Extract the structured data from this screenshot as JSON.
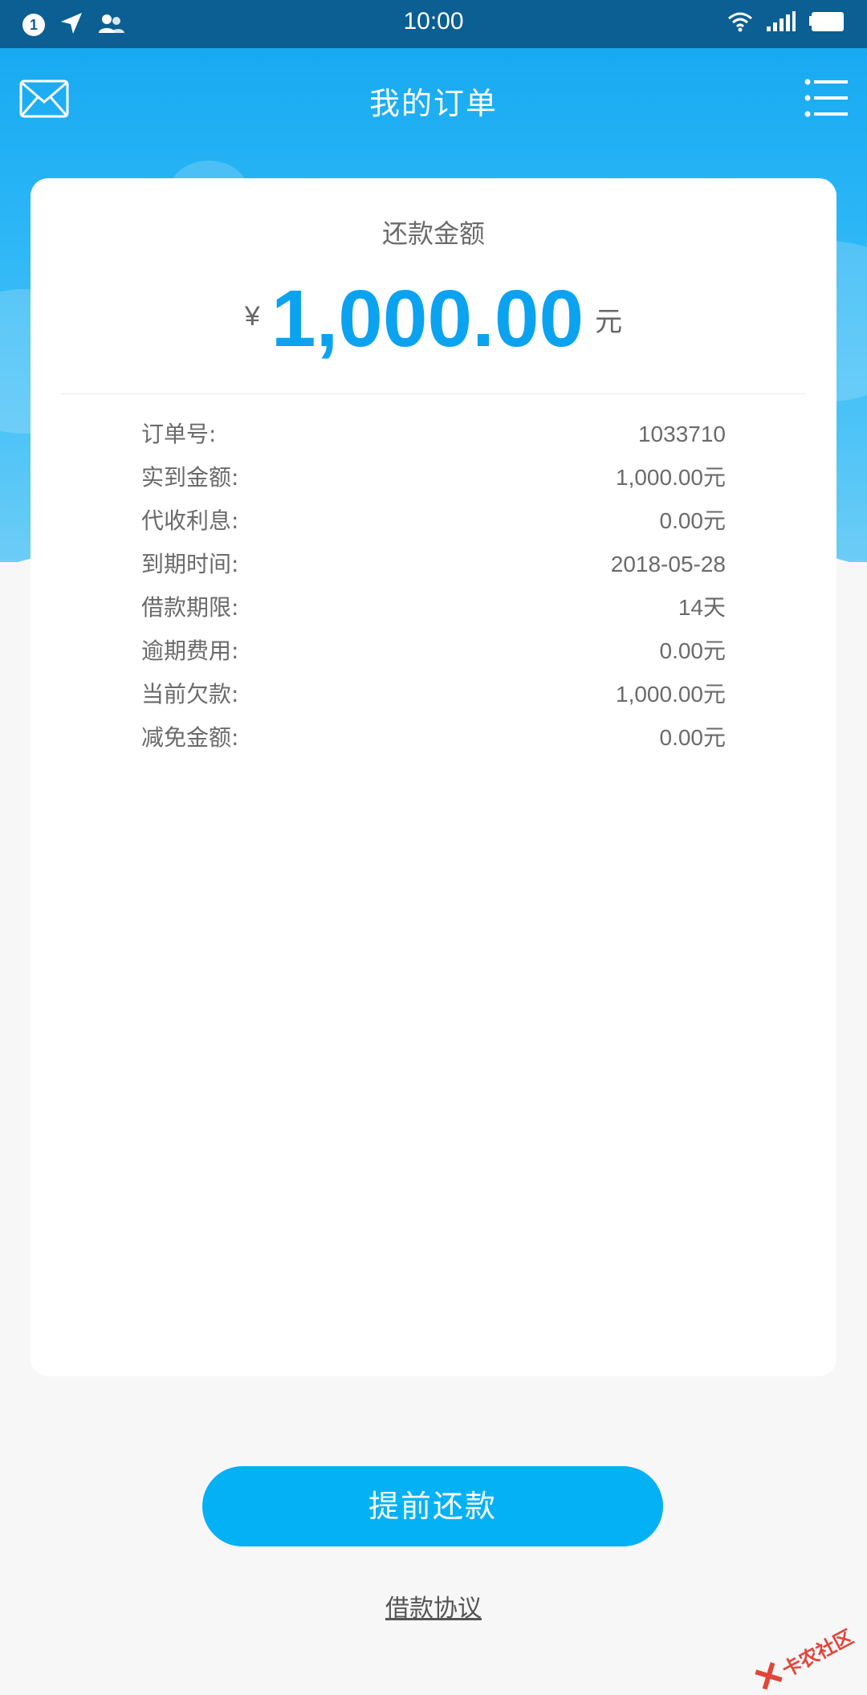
{
  "status_bar": {
    "notification_count": "1",
    "time": "10:00"
  },
  "header": {
    "title": "我的订单"
  },
  "card": {
    "amount_label": "还款金额",
    "currency_symbol": "¥",
    "amount": "1,000.00",
    "amount_unit": "元",
    "rows": [
      {
        "label": "订单号:",
        "value": "1033710"
      },
      {
        "label": "实到金额:",
        "value": "1,000.00元"
      },
      {
        "label": "代收利息:",
        "value": "0.00元"
      },
      {
        "label": "到期时间:",
        "value": "2018-05-28"
      },
      {
        "label": "借款期限:",
        "value": "14天"
      },
      {
        "label": "逾期费用:",
        "value": "0.00元"
      },
      {
        "label": "当前欠款:",
        "value": "1,000.00元"
      },
      {
        "label": "减免金额:",
        "value": "0.00元"
      }
    ]
  },
  "actions": {
    "repay_label": "提前还款",
    "agreement_label": "借款协议"
  },
  "watermark": {
    "text": "卡农社区"
  },
  "colors": {
    "accent": "#0ba3ef",
    "button": "#05b1f5",
    "status_bar": "#0b5f93"
  }
}
